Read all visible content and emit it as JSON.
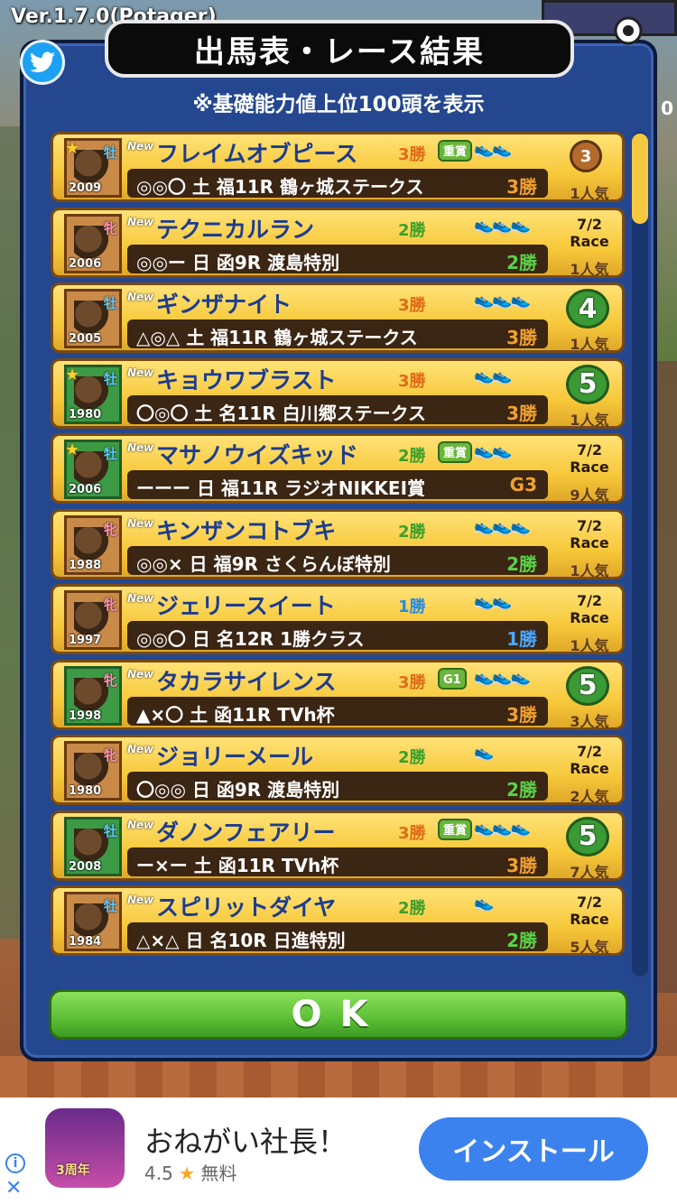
{
  "version": "Ver.1.7.0(Potager)",
  "panel": {
    "title": "出馬表・レース結果",
    "subtitle": "※基礎能力値上位100頭を表示"
  },
  "top_right_number": "0",
  "horses": [
    {
      "name": "フレイムオブピース",
      "sex": "牡",
      "year": "2009",
      "star": true,
      "portrait": "brown",
      "wins": "3勝",
      "wins_color": "#e06a18",
      "grade": "重賞",
      "shoes": "👟👟",
      "marks": "◎◎〇",
      "day": "土",
      "race": "福11R",
      "race_name": "鶴ヶ城ステークス",
      "result": "3勝",
      "result_color": "#f0a030",
      "date": "",
      "rank": "3",
      "rank_type": "medal",
      "popularity": "1人気"
    },
    {
      "name": "テクニカルラン",
      "sex": "牝",
      "year": "2006",
      "star": false,
      "portrait": "brown",
      "wins": "2勝",
      "wins_color": "#3aa02a",
      "grade": "",
      "shoes": "👟👟👟",
      "marks": "◎◎ー",
      "day": "日",
      "race": "函9R",
      "race_name": "渡島特別",
      "result": "2勝",
      "result_color": "#5bd04a",
      "date": "7/2 Race",
      "rank": "",
      "rank_type": "date",
      "popularity": "1人気"
    },
    {
      "name": "ギンザナイト",
      "sex": "牡",
      "year": "2005",
      "star": false,
      "portrait": "brown",
      "wins": "3勝",
      "wins_color": "#e06a18",
      "grade": "",
      "shoes": "👟👟👟",
      "marks": "△◎△",
      "day": "土",
      "race": "福11R",
      "race_name": "鶴ヶ城ステークス",
      "result": "3勝",
      "result_color": "#f0a030",
      "date": "",
      "rank": "4",
      "rank_type": "laurel",
      "popularity": "1人気"
    },
    {
      "name": "キョウワブラスト",
      "sex": "牡",
      "year": "1980",
      "star": true,
      "portrait": "green",
      "wins": "3勝",
      "wins_color": "#e06a18",
      "grade": "",
      "shoes": "👟👟",
      "marks": "〇◎〇",
      "day": "土",
      "race": "名11R",
      "race_name": "白川郷ステークス",
      "result": "3勝",
      "result_color": "#f0a030",
      "date": "",
      "rank": "5",
      "rank_type": "laurel",
      "popularity": "1人気"
    },
    {
      "name": "マサノウイズキッド",
      "sex": "牡",
      "year": "2006",
      "star": true,
      "portrait": "green",
      "wins": "2勝",
      "wins_color": "#3aa02a",
      "grade": "重賞",
      "shoes": "👟👟",
      "marks": "ーーー",
      "day": "日",
      "race": "福11R",
      "race_name": "ラジオNIKKEI賞",
      "result": "G3",
      "result_color": "#f0a030",
      "date": "7/2 Race",
      "rank": "",
      "rank_type": "date",
      "popularity": "9人気"
    },
    {
      "name": "キンザンコトブキ",
      "sex": "牝",
      "year": "1988",
      "star": false,
      "portrait": "brown",
      "wins": "2勝",
      "wins_color": "#3aa02a",
      "grade": "",
      "shoes": "👟👟👟",
      "marks": "◎◎×",
      "day": "日",
      "race": "福9R",
      "race_name": "さくらんぼ特別",
      "result": "2勝",
      "result_color": "#5bd04a",
      "date": "7/2 Race",
      "rank": "",
      "rank_type": "date",
      "popularity": "1人気"
    },
    {
      "name": "ジェリースイート",
      "sex": "牝",
      "year": "1997",
      "star": false,
      "portrait": "brown",
      "wins": "1勝",
      "wins_color": "#2a8ae0",
      "grade": "",
      "shoes": "👟👟",
      "marks": "◎◎〇",
      "day": "日",
      "race": "名12R",
      "race_name": "1勝クラス",
      "result": "1勝",
      "result_color": "#4aa8ff",
      "date": "7/2 Race",
      "rank": "",
      "rank_type": "date",
      "popularity": "1人気"
    },
    {
      "name": "タカラサイレンス",
      "sex": "牝",
      "year": "1998",
      "star": false,
      "portrait": "green",
      "wins": "3勝",
      "wins_color": "#e06a18",
      "grade": "G1",
      "shoes": "👟👟👟",
      "marks": "▲×〇",
      "day": "土",
      "race": "函11R",
      "race_name": "TVh杯",
      "result": "3勝",
      "result_color": "#f0a030",
      "date": "",
      "rank": "5",
      "rank_type": "laurel",
      "popularity": "3人気"
    },
    {
      "name": "ジョリーメール",
      "sex": "牝",
      "year": "1980",
      "star": false,
      "portrait": "brown",
      "wins": "2勝",
      "wins_color": "#3aa02a",
      "grade": "",
      "shoes": "👟",
      "marks": "〇◎◎",
      "day": "日",
      "race": "函9R",
      "race_name": "渡島特別",
      "result": "2勝",
      "result_color": "#5bd04a",
      "date": "7/2 Race",
      "rank": "",
      "rank_type": "date",
      "popularity": "2人気"
    },
    {
      "name": "ダノンフェアリー",
      "sex": "牡",
      "year": "2008",
      "star": false,
      "portrait": "green",
      "wins": "3勝",
      "wins_color": "#e06a18",
      "grade": "重賞",
      "shoes": "👟👟👟",
      "marks": "ー×ー",
      "day": "土",
      "race": "函11R",
      "race_name": "TVh杯",
      "result": "3勝",
      "result_color": "#f0a030",
      "date": "",
      "rank": "5",
      "rank_type": "laurel",
      "popularity": "7人気"
    },
    {
      "name": "スピリットダイヤ",
      "sex": "牡",
      "year": "1984",
      "star": false,
      "portrait": "brown",
      "wins": "2勝",
      "wins_color": "#3aa02a",
      "grade": "",
      "shoes": "👟",
      "marks": "△×△",
      "day": "日",
      "race": "名10R",
      "race_name": "日進特別",
      "result": "2勝",
      "result_color": "#5bd04a",
      "date": "7/2 Race",
      "rank": "",
      "rank_type": "date",
      "popularity": "5人気"
    }
  ],
  "new_label": "New",
  "ok_button": "OK",
  "ad": {
    "title": "おねがい社長！",
    "rating": "4.5",
    "price": "無料",
    "install": "インストール",
    "icon_label": "3周年"
  },
  "colors": {
    "panel_bg": "#24478f",
    "card_gold": "#f7c83a",
    "ok_green": "#5bbf35",
    "install_blue": "#3b82ee"
  }
}
